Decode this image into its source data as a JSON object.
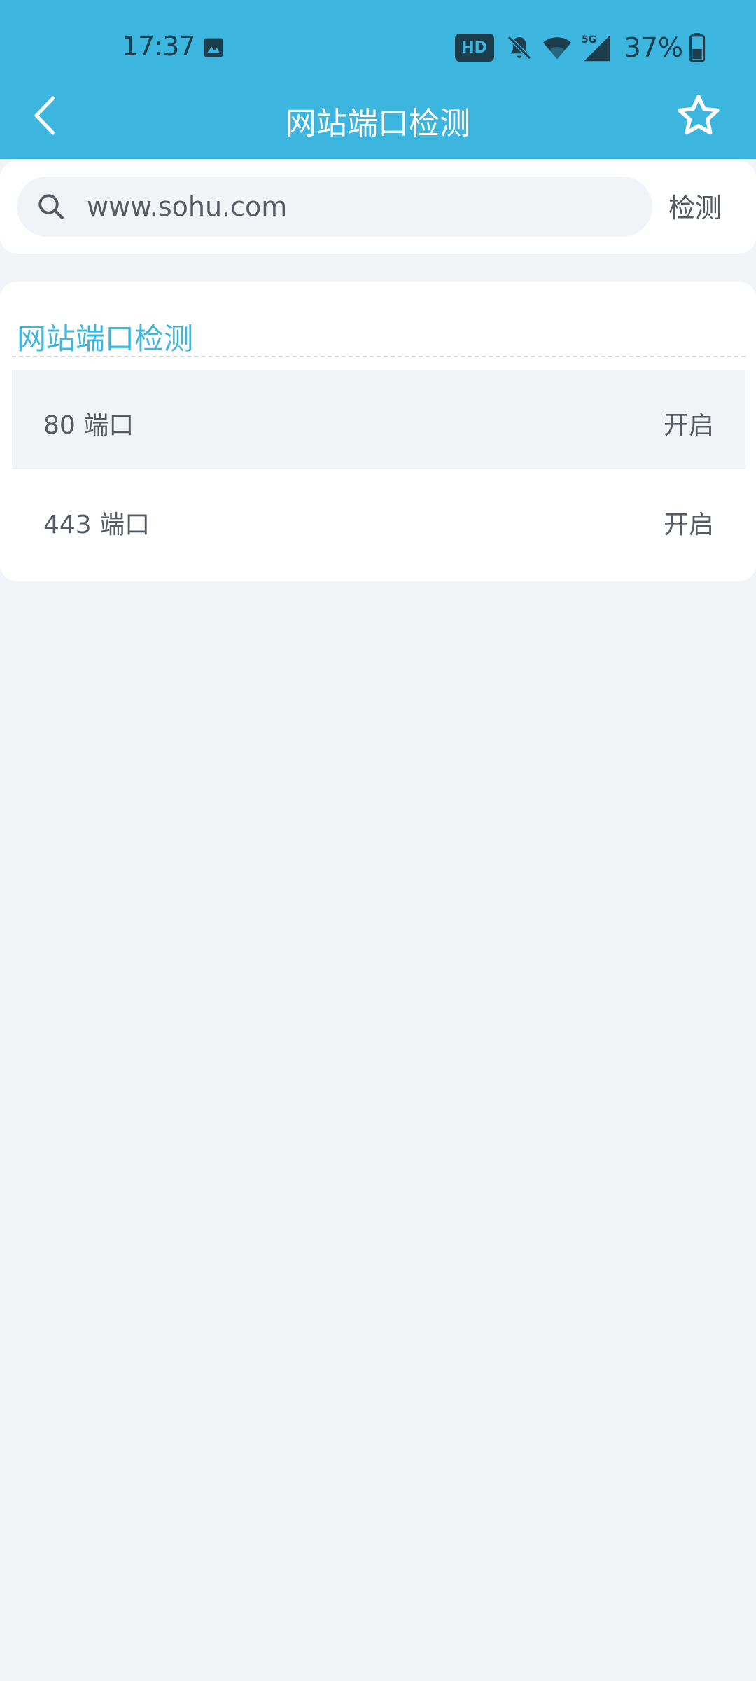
{
  "status_bar": {
    "time": "17:37",
    "hd_badge": "HD",
    "battery_percent": "37%",
    "icons": [
      "gallery-icon",
      "hd-badge",
      "bell-muted-icon",
      "wifi-icon",
      "signal-5g-icon",
      "battery-icon"
    ]
  },
  "header": {
    "title": "网站端口检测",
    "back_icon": "chevron-left-icon",
    "favorite_icon": "star-outline-icon"
  },
  "search": {
    "value": "www.sohu.com",
    "button_label": "检测",
    "icon": "search-icon"
  },
  "results": {
    "section_title": "网站端口检测",
    "rows": [
      {
        "port": "80 端口",
        "status": "开启"
      },
      {
        "port": "443 端口",
        "status": "开启"
      }
    ]
  },
  "colors": {
    "accent": "#3cb5df",
    "background": "#f0f4f7",
    "card": "#ffffff",
    "text": "#555b62",
    "status_icons": "#1c3d4c"
  }
}
